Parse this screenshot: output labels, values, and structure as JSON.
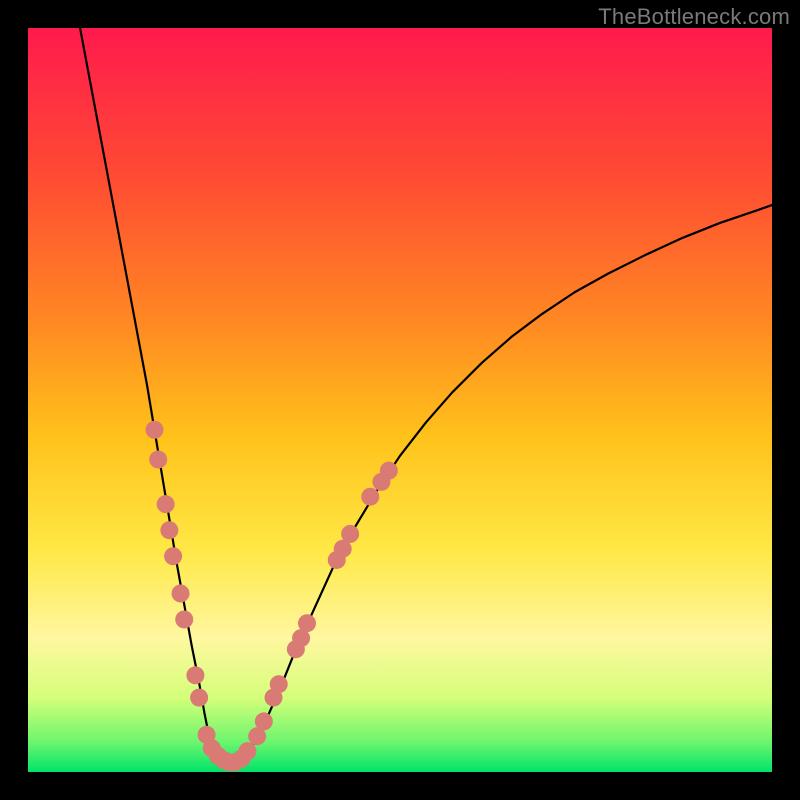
{
  "watermark": "TheBottleneck.com",
  "chart_data": {
    "type": "line",
    "title": "",
    "xlabel": "",
    "ylabel": "",
    "xlim": [
      0,
      100
    ],
    "ylim": [
      0,
      100
    ],
    "grid": false,
    "legend": false,
    "background_gradient": {
      "top_color": "#ff1a4d",
      "mid_color": "#ffd012",
      "bottom_color": "#00e46a",
      "stops": [
        {
          "offset": 0.0,
          "color": "#ff1a4d"
        },
        {
          "offset": 0.2,
          "color": "#ff4b33"
        },
        {
          "offset": 0.4,
          "color": "#ff8a22"
        },
        {
          "offset": 0.55,
          "color": "#ffc21a"
        },
        {
          "offset": 0.7,
          "color": "#ffe845"
        },
        {
          "offset": 0.82,
          "color": "#fff7a0"
        },
        {
          "offset": 0.9,
          "color": "#d5ff7a"
        },
        {
          "offset": 0.96,
          "color": "#6cf56e"
        },
        {
          "offset": 1.0,
          "color": "#00e46a"
        }
      ]
    },
    "series": [
      {
        "name": "curve",
        "color": "#000000",
        "x": [
          7.0,
          8.5,
          10.0,
          11.5,
          13.0,
          14.5,
          16.0,
          17.0,
          18.0,
          19.0,
          20.0,
          21.0,
          22.0,
          23.0,
          23.7,
          24.3,
          25.0,
          26.0,
          27.0,
          28.0,
          29.2,
          30.5,
          32.0,
          34.0,
          36.0,
          38.5,
          41.0,
          44.0,
          47.0,
          50.0,
          53.5,
          57.0,
          61.0,
          65.0,
          69.0,
          73.5,
          78.0,
          83.0,
          88.0,
          93.0,
          98.0,
          100.0
        ],
        "y": [
          100.0,
          92.0,
          84.0,
          76.0,
          68.0,
          60.0,
          52.0,
          46.0,
          40.0,
          34.0,
          28.0,
          22.5,
          17.0,
          12.0,
          8.0,
          5.0,
          2.8,
          1.4,
          1.0,
          1.2,
          2.2,
          4.0,
          7.0,
          11.5,
          16.5,
          22.0,
          27.5,
          33.0,
          38.0,
          42.5,
          47.0,
          51.0,
          55.0,
          58.5,
          61.5,
          64.5,
          67.0,
          69.5,
          71.8,
          73.8,
          75.5,
          76.2
        ]
      }
    ],
    "scatter": {
      "name": "dots",
      "color": "#d97a74",
      "radius": 9,
      "points": [
        {
          "x": 17.0,
          "y": 46.0
        },
        {
          "x": 17.5,
          "y": 42.0
        },
        {
          "x": 18.5,
          "y": 36.0
        },
        {
          "x": 19.0,
          "y": 32.5
        },
        {
          "x": 19.5,
          "y": 29.0
        },
        {
          "x": 20.5,
          "y": 24.0
        },
        {
          "x": 21.0,
          "y": 20.5
        },
        {
          "x": 22.5,
          "y": 13.0
        },
        {
          "x": 23.0,
          "y": 10.0
        },
        {
          "x": 24.0,
          "y": 5.0
        },
        {
          "x": 24.7,
          "y": 3.2
        },
        {
          "x": 25.5,
          "y": 2.2
        },
        {
          "x": 26.3,
          "y": 1.6
        },
        {
          "x": 27.0,
          "y": 1.3
        },
        {
          "x": 27.8,
          "y": 1.3
        },
        {
          "x": 28.7,
          "y": 1.8
        },
        {
          "x": 29.5,
          "y": 2.8
        },
        {
          "x": 30.8,
          "y": 4.8
        },
        {
          "x": 31.7,
          "y": 6.8
        },
        {
          "x": 33.0,
          "y": 10.0
        },
        {
          "x": 33.7,
          "y": 11.8
        },
        {
          "x": 36.0,
          "y": 16.5
        },
        {
          "x": 36.7,
          "y": 18.0
        },
        {
          "x": 37.5,
          "y": 20.0
        },
        {
          "x": 41.5,
          "y": 28.5
        },
        {
          "x": 42.3,
          "y": 30.0
        },
        {
          "x": 43.3,
          "y": 32.0
        },
        {
          "x": 46.0,
          "y": 37.0
        },
        {
          "x": 47.5,
          "y": 39.0
        },
        {
          "x": 48.5,
          "y": 40.5
        }
      ]
    }
  }
}
